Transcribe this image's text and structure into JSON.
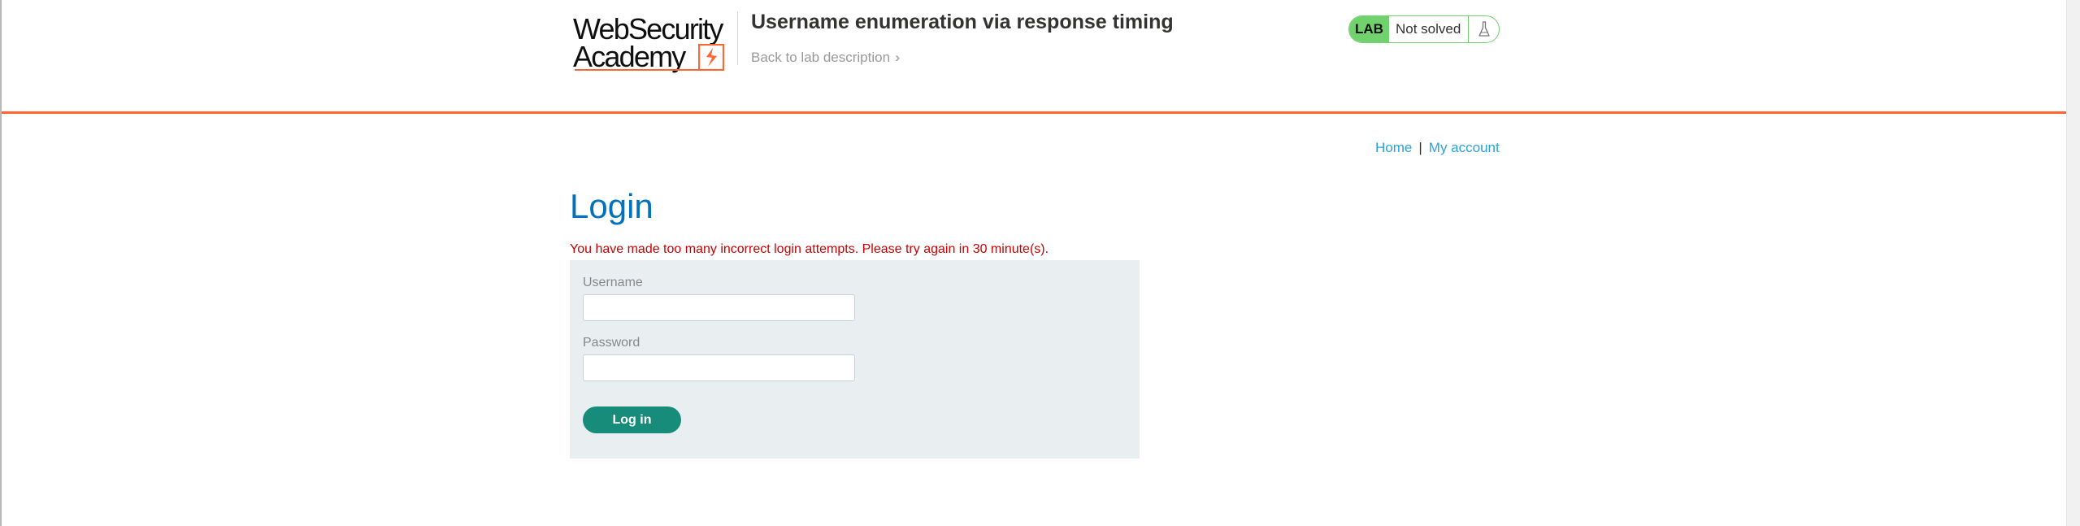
{
  "header": {
    "logo_line_1": "WebSecurity",
    "logo_line_2": "Academy",
    "lab_title": "Username enumeration via response timing",
    "back_link": "Back to lab description",
    "back_link_icon": "double-chevron-right-icon",
    "lab_badge": "LAB",
    "lab_status": "Not solved",
    "status_icon": "flask-icon",
    "accent_color": "#ff6633",
    "status_color": "#70d16d"
  },
  "nav": {
    "home": "Home",
    "separator": "|",
    "my_account": "My account"
  },
  "main": {
    "title": "Login",
    "error": "You have made too many incorrect login attempts. Please try again in 30 minute(s).",
    "username_label": "Username",
    "username_value": "",
    "password_label": "Password",
    "password_value": "",
    "submit_label": "Log in",
    "title_color": "#0071bc",
    "error_color": "#cc0000",
    "button_color": "#188c7a"
  }
}
